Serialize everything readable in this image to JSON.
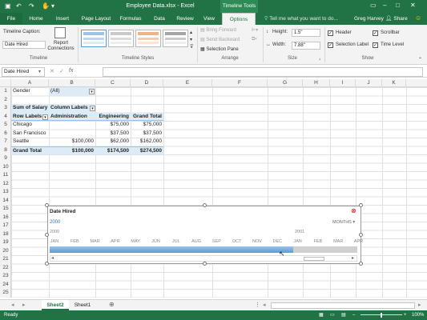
{
  "titlebar": {
    "title": "Employee Data.xlsx - Excel",
    "context_title": "Timeline Tools",
    "user": "Greg Harvey",
    "share": "Share"
  },
  "tabs": [
    "File",
    "Home",
    "Insert",
    "Page Layout",
    "Formulas",
    "Data",
    "Review",
    "View",
    "Options"
  ],
  "tell_me": "Tell me what you want to do...",
  "ribbon": {
    "timeline_group": {
      "caption_label": "Timeline Caption:",
      "caption_value": "Date Hired",
      "report_connections": "Report Connections",
      "label": "Timeline"
    },
    "styles_group": {
      "label": "Timeline Styles"
    },
    "arrange_group": {
      "bring_forward": "Bring Forward",
      "send_backward": "Send Backward",
      "selection_pane": "Selection Pane",
      "label": "Arrange"
    },
    "size_group": {
      "height_label": "Height:",
      "height_value": "1.5\"",
      "width_label": "Width:",
      "width_value": "7.88\"",
      "label": "Size"
    },
    "show_group": {
      "header": "Header",
      "scrollbar": "Scrollbar",
      "selection_label": "Selection Label",
      "time_level": "Time Level",
      "label": "Show"
    }
  },
  "formula_bar": {
    "name_box": "Date Hired",
    "fx": "fx"
  },
  "columns": [
    "A",
    "B",
    "C",
    "D",
    "E",
    "F",
    "G",
    "H",
    "I",
    "J",
    "K"
  ],
  "rows": [
    "1",
    "2",
    "3",
    "4",
    "5",
    "6",
    "7",
    "8",
    "9",
    "10",
    "11",
    "12",
    "13",
    "14",
    "15",
    "16",
    "17",
    "18",
    "19",
    "20",
    "21",
    "22",
    "23",
    "24",
    "25"
  ],
  "pivot": {
    "filter_label": "Gender",
    "filter_value": "(All)",
    "sum_label": "Sum of Salary",
    "col_labels": "Column Labels",
    "row_labels": "Row Labels",
    "headers": [
      "Administration",
      "Engineering",
      "Grand Total"
    ],
    "data": [
      {
        "city": "Chicago",
        "admin": "",
        "eng": "$75,000",
        "total": "$75,000"
      },
      {
        "city": "San Francisco",
        "admin": "",
        "eng": "$37,500",
        "total": "$37,500"
      },
      {
        "city": "Seattle",
        "admin": "$100,000",
        "eng": "$62,000",
        "total": "$162,000"
      }
    ],
    "grand_total": {
      "label": "Grand Total",
      "admin": "$100,000",
      "eng": "$174,500",
      "total": "$274,500"
    }
  },
  "timeline": {
    "header": "Date Hired",
    "selection_label": "2000",
    "level": "MONTHS",
    "year1": "2000",
    "year2": "2001",
    "months": [
      "JAN",
      "FEB",
      "MAR",
      "APR",
      "MAY",
      "JUN",
      "JUL",
      "AUG",
      "SEP",
      "OCT",
      "NOV",
      "DEC",
      "JAN",
      "FEB",
      "MAR",
      "APR"
    ],
    "selected_months": 12
  },
  "sheets": [
    "Sheet2",
    "Sheet1"
  ],
  "status": {
    "ready": "Ready",
    "zoom": "100%"
  },
  "colors": {
    "excel_green": "#217346",
    "pivot_header": "#ddebf7",
    "timeline_bar": "#5b9bd5"
  }
}
